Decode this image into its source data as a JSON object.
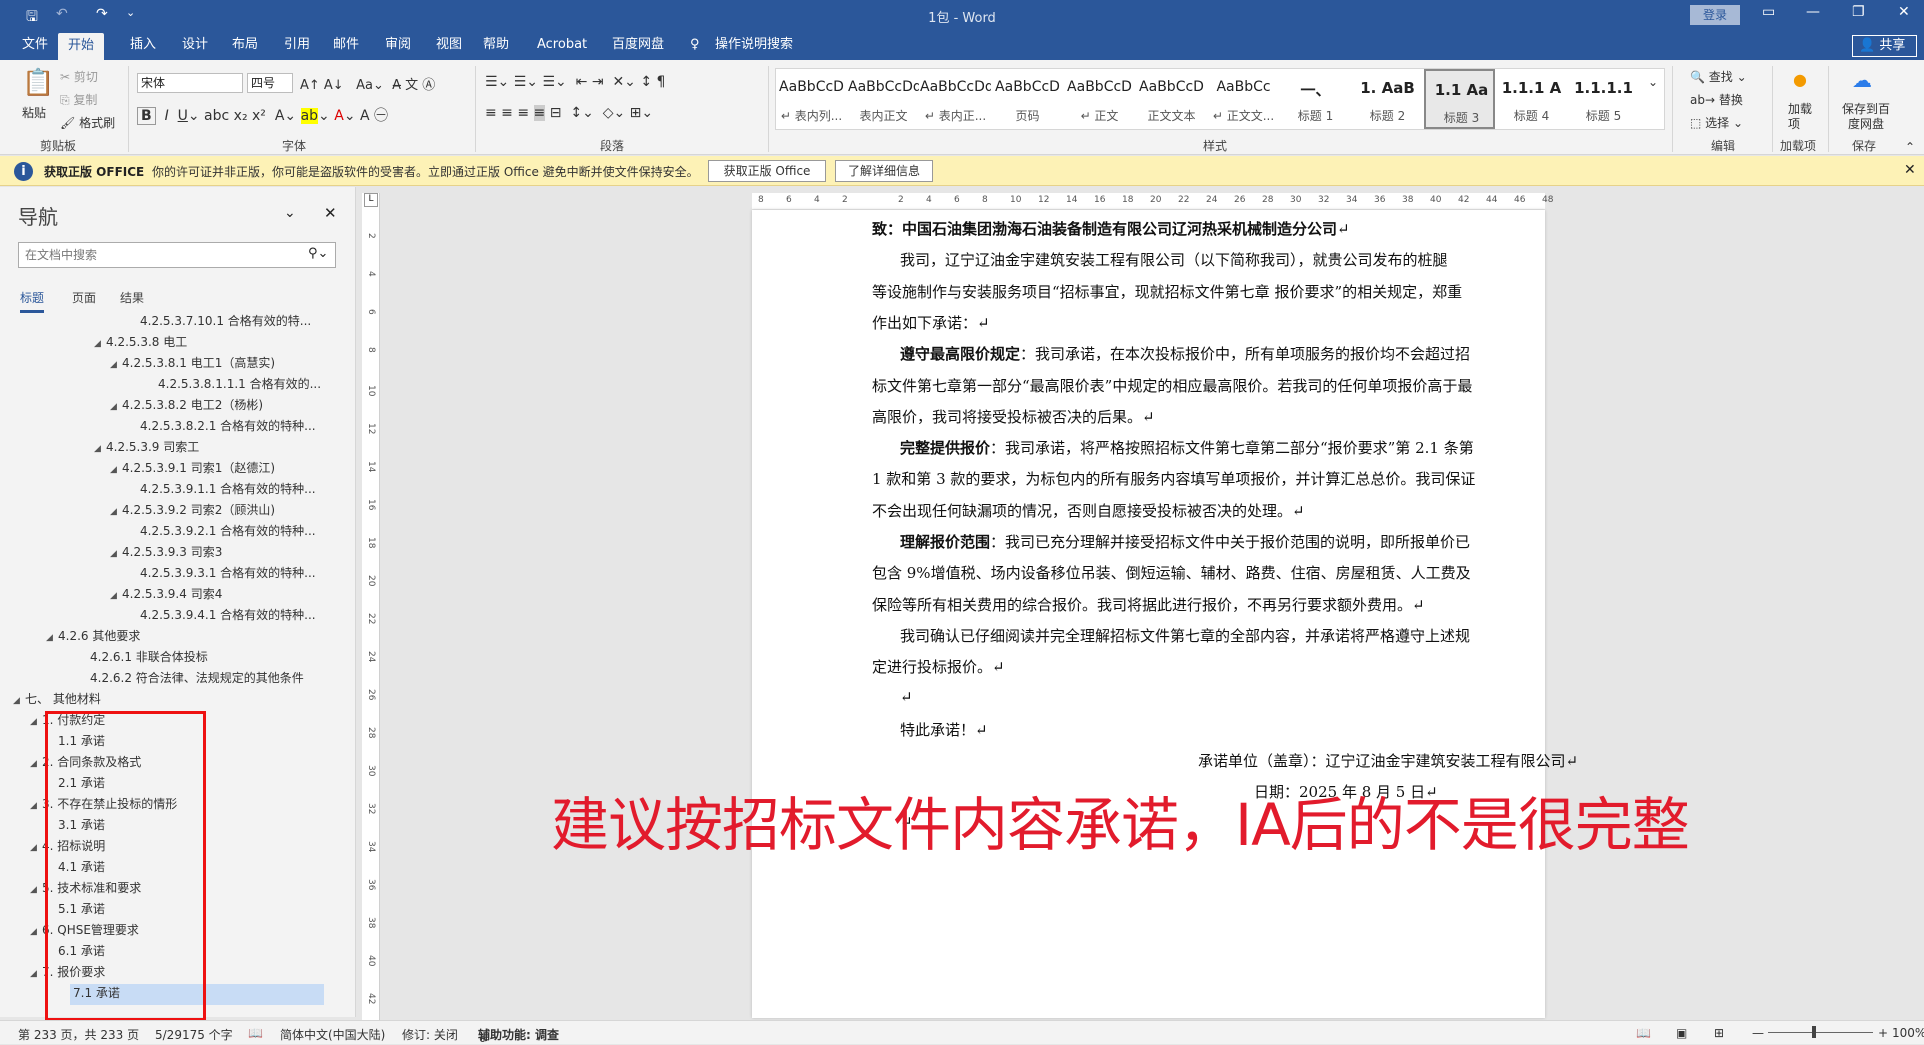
{
  "app": {
    "title": "1包 - Word",
    "login": "登录",
    "share": "共享"
  },
  "tabs": [
    "文件",
    "开始",
    "插入",
    "设计",
    "布局",
    "引用",
    "邮件",
    "审阅",
    "视图",
    "帮助",
    "Acrobat",
    "百度网盘"
  ],
  "tell_me": "操作说明搜索",
  "ribbon": {
    "clipboard": {
      "paste": "粘贴",
      "cut": "剪切",
      "copy": "复制",
      "format_painter": "格式刷",
      "label": "剪贴板"
    },
    "font": {
      "name": "宋体",
      "size": "四号",
      "label": "字体"
    },
    "paragraph": {
      "label": "段落"
    },
    "styles": {
      "label": "样式",
      "items": [
        {
          "preview": "AaBbCcD",
          "name": "↵ 表内列..."
        },
        {
          "preview": "AaBbCcDd",
          "name": "表内正文"
        },
        {
          "preview": "AaBbCcDd",
          "name": "↵ 表内正..."
        },
        {
          "preview": "AaBbCcD",
          "name": "页码"
        },
        {
          "preview": "AaBbCcD",
          "name": "↵ 正文"
        },
        {
          "preview": "AaBbCcD",
          "name": "正文文本"
        },
        {
          "preview": "AaBbCc",
          "name": "↵ 正文文..."
        },
        {
          "preview": "一、",
          "name": "标题 1"
        },
        {
          "preview": "1. AaB",
          "name": "标题 2"
        },
        {
          "preview": "1.1 Aa",
          "name": "标题 3"
        },
        {
          "preview": "1.1.1 A",
          "name": "标题 4"
        },
        {
          "preview": "1.1.1.1",
          "name": "标题 5"
        }
      ]
    },
    "editing": {
      "find": "查找",
      "replace": "替换",
      "select": "选择",
      "label": "编辑"
    },
    "addins": {
      "load": "加载项",
      "label": "加载项"
    },
    "save": {
      "save_to": "保存到百度网盘",
      "label": "保存"
    }
  },
  "notice": {
    "title": "获取正版 OFFICE",
    "text": "你的许可证并非正版，你可能是盗版软件的受害者。立即通过正版 Office 避免中断并使文件保持安全。",
    "btn1": "获取正版 Office",
    "btn2": "了解详细信息"
  },
  "nav": {
    "title": "导航",
    "search_placeholder": "在文档中搜索",
    "tabs": [
      "标题",
      "页面",
      "结果"
    ],
    "items": [
      {
        "text": "4.2.5.3.7.10.1 合格有效的特...",
        "lvl": 6,
        "tri": ""
      },
      {
        "text": "4.2.5.3.8 电工",
        "lvl": 4,
        "tri": "◢"
      },
      {
        "text": "4.2.5.3.8.1 电工1（高慧实)",
        "lvl": 5,
        "tri": "◢"
      },
      {
        "text": "4.2.5.3.8.1.1.1 合格有效的...",
        "lvl": 7,
        "tri": ""
      },
      {
        "text": "4.2.5.3.8.2 电工2（杨彬)",
        "lvl": 5,
        "tri": "◢"
      },
      {
        "text": "4.2.5.3.8.2.1 合格有效的特种...",
        "lvl": 6,
        "tri": ""
      },
      {
        "text": "4.2.5.3.9 司索工",
        "lvl": 4,
        "tri": "◢"
      },
      {
        "text": "4.2.5.3.9.1 司索1（赵德江)",
        "lvl": 5,
        "tri": "◢"
      },
      {
        "text": "4.2.5.3.9.1.1 合格有效的特种...",
        "lvl": 6,
        "tri": ""
      },
      {
        "text": "4.2.5.3.9.2 司索2（顾洪山)",
        "lvl": 5,
        "tri": "◢"
      },
      {
        "text": "4.2.5.3.9.2.1 合格有效的特种...",
        "lvl": 6,
        "tri": ""
      },
      {
        "text": "4.2.5.3.9.3 司索3",
        "lvl": 5,
        "tri": "◢"
      },
      {
        "text": "4.2.5.3.9.3.1 合格有效的特种...",
        "lvl": 6,
        "tri": ""
      },
      {
        "text": "4.2.5.3.9.4 司索4",
        "lvl": 5,
        "tri": "◢"
      },
      {
        "text": "4.2.5.3.9.4.1 合格有效的特种...",
        "lvl": 6,
        "tri": ""
      },
      {
        "text": "4.2.6 其他要求",
        "lvl": 2,
        "tri": "◢"
      },
      {
        "text": "4.2.6.1 非联合体投标",
        "lvl": 3,
        "tri": ""
      },
      {
        "text": "4.2.6.2 符合法律、法规规定的其他条件",
        "lvl": 3,
        "tri": ""
      },
      {
        "text": "七、 其他材料",
        "lvl": 0,
        "tri": "◢"
      },
      {
        "text": "1. 付款约定",
        "lvl": 1,
        "tri": "◢"
      },
      {
        "text": "1.1 承诺",
        "lvl": 2,
        "tri": ""
      },
      {
        "text": "2. 合同条款及格式",
        "lvl": 1,
        "tri": "◢"
      },
      {
        "text": "2.1 承诺",
        "lvl": 2,
        "tri": ""
      },
      {
        "text": "3. 不存在禁止投标的情形",
        "lvl": 1,
        "tri": "◢"
      },
      {
        "text": "3.1 承诺",
        "lvl": 2,
        "tri": ""
      },
      {
        "text": "4. 招标说明",
        "lvl": 1,
        "tri": "◢"
      },
      {
        "text": "4.1 承诺",
        "lvl": 2,
        "tri": ""
      },
      {
        "text": "5. 技术标准和要求",
        "lvl": 1,
        "tri": "◢"
      },
      {
        "text": "5.1 承诺",
        "lvl": 2,
        "tri": ""
      },
      {
        "text": "6. QHSE管理要求",
        "lvl": 1,
        "tri": "◢"
      },
      {
        "text": "6.1 承诺",
        "lvl": 2,
        "tri": ""
      },
      {
        "text": "7. 报价要求",
        "lvl": 1,
        "tri": "◢"
      },
      {
        "text": "7.1 承诺",
        "lvl": 2,
        "tri": "",
        "selected": true
      }
    ]
  },
  "document": {
    "lines": [
      {
        "html": "<b>致：中国石油集团渤海石油装备制造有限公司辽河热采机械制造分公司</b>↵",
        "indent": 0
      },
      {
        "html": "我司，辽宁辽油金宇建筑安装工程有限公司（以下简称我司），就贵公司发布的桩腿",
        "indent": 1
      },
      {
        "html": "等设施制作与安装服务项目“招标事宜，现就招标文件第七章 报价要求”的相关规定，郑重",
        "indent": 0
      },
      {
        "html": "作出如下承诺：↵",
        "indent": 0
      },
      {
        "html": "<b>遵守最高限价规定</b>：我司承诺，在本次投标报价中，所有单项服务的报价均不会超过招",
        "indent": 1
      },
      {
        "html": "标文件第七章第一部分“最高限价表”中规定的相应最高限价。若我司的任何单项报价高于最",
        "indent": 0
      },
      {
        "html": "高限价，我司将接受投标被否决的后果。↵",
        "indent": 0
      },
      {
        "html": "<b>完整提供报价</b>：我司承诺，将严格按照招标文件第七章第二部分“报价要求”第 2.1 条第",
        "indent": 1
      },
      {
        "html": "1 款和第 3 款的要求，为标包内的所有服务内容填写单项报价，并计算汇总总价。我司保证",
        "indent": 0
      },
      {
        "html": "不会出现任何缺漏项的情况，否则自愿接受投标被否决的处理。↵",
        "indent": 0
      },
      {
        "html": "<b>理解报价范围</b>：我司已充分理解并接受招标文件中关于报价范围的说明，即所报单价已",
        "indent": 1
      },
      {
        "html": "包含 9%增值税、场内设备移位吊装、倒短运输、辅材、路费、住宿、房屋租赁、人工费及",
        "indent": 0
      },
      {
        "html": "保险等所有相关费用的综合报价。我司将据此进行报价，不再另行要求额外费用。↵",
        "indent": 0
      },
      {
        "html": "我司确认已仔细阅读并完全理解招标文件第七章的全部内容，并承诺将严格遵守上述规",
        "indent": 1
      },
      {
        "html": "定进行投标报价。↵",
        "indent": 0
      },
      {
        "html": "↵",
        "indent": 1
      },
      {
        "html": "特此承诺！↵",
        "indent": 1
      },
      {
        "html": "承诺单位（盖章）：辽宁辽油金宇建筑安装工程有限公司↵",
        "indent": 2
      },
      {
        "html": "日期：2025 年 8 月 5 日↵",
        "indent": 3
      },
      {
        "html": "↵",
        "indent": 1
      }
    ]
  },
  "status": {
    "page": "第 233 页，共 233 页",
    "words": "5/29175 个字",
    "lang": "简体中文(中国大陆)",
    "track": "修订: 关闭",
    "access": "辅助功能: 调查",
    "zoom": "100%"
  },
  "annotation": "建议按招标文件内容承诺，IA后的不是很完整",
  "colors": {
    "accent": "#2b579a",
    "annotation": "#e21b2c"
  }
}
